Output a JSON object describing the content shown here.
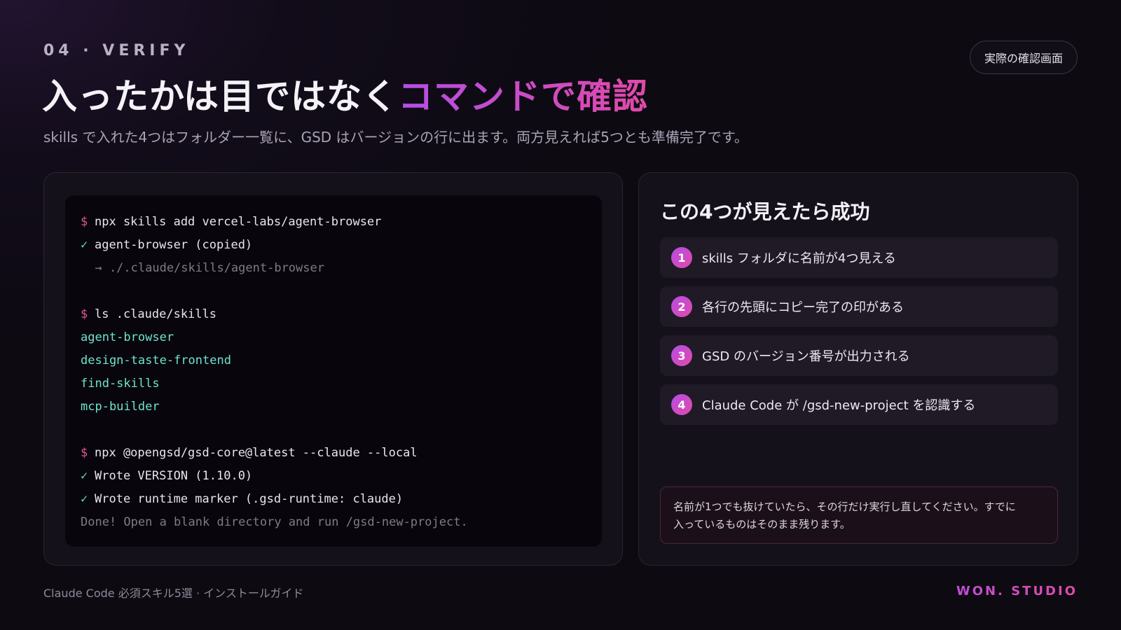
{
  "header": {
    "eyebrow": "04 · VERIFY",
    "title_plain": "入ったかは目ではなく",
    "title_accent": "コマンドで確認",
    "subtitle": "skills で入れた4つはフォルダー一覧に、GSD はバージョンの行に出ます。両方見えれば5つとも準備完了です。",
    "pill_label": "実際の確認画面"
  },
  "terminal": {
    "lines": [
      {
        "sym": "$",
        "sym_kind": "prompt",
        "text": "npx skills add vercel-labs/agent-browser",
        "style": "white"
      },
      {
        "sym": "✓",
        "sym_kind": "check",
        "text": "agent-browser (copied)",
        "style": "white"
      },
      {
        "sym": "",
        "sym_kind": "none",
        "text": "  → ./.claude/skills/agent-browser",
        "style": "dim"
      },
      {
        "sym": "",
        "sym_kind": "blank",
        "text": "",
        "style": "white"
      },
      {
        "sym": "$",
        "sym_kind": "prompt",
        "text": "ls .claude/skills",
        "style": "white"
      },
      {
        "sym": "",
        "sym_kind": "none",
        "text": "agent-browser",
        "style": "teal"
      },
      {
        "sym": "",
        "sym_kind": "none",
        "text": "design-taste-frontend",
        "style": "teal"
      },
      {
        "sym": "",
        "sym_kind": "none",
        "text": "find-skills",
        "style": "teal"
      },
      {
        "sym": "",
        "sym_kind": "none",
        "text": "mcp-builder",
        "style": "teal"
      },
      {
        "sym": "",
        "sym_kind": "blank",
        "text": "",
        "style": "white"
      },
      {
        "sym": "$",
        "sym_kind": "prompt",
        "text": "npx @opengsd/gsd-core@latest --claude --local",
        "style": "white"
      },
      {
        "sym": "✓",
        "sym_kind": "check",
        "text": "Wrote VERSION (1.10.0)",
        "style": "white"
      },
      {
        "sym": "✓",
        "sym_kind": "check",
        "text": "Wrote runtime marker (.gsd-runtime: claude)",
        "style": "white"
      },
      {
        "sym": "",
        "sym_kind": "none",
        "text": "Done! Open a blank directory and run /gsd-new-project.",
        "style": "dim"
      }
    ]
  },
  "checklist": {
    "title": "この4つが見えたら成功",
    "items": [
      {
        "num": "1",
        "text": "skills フォルダに名前が4つ見える"
      },
      {
        "num": "2",
        "text": "各行の先頭にコピー完了の印がある"
      },
      {
        "num": "3",
        "text": "GSD のバージョン番号が出力される"
      },
      {
        "num": "4",
        "text": "Claude Code が /gsd-new-project を認識する"
      }
    ],
    "note_line1": "名前が1つでも抜けていたら、その行だけ実行し直してください。すでに",
    "note_line2": "入っているものはそのまま残ります。"
  },
  "footer": {
    "left": "Claude Code 必須スキル5選 · インストールガイド",
    "right": "WON. STUDIO"
  },
  "colors": {
    "accent_purple": "#b44ee6",
    "accent_pink": "#e04aa8",
    "terminal_teal": "#6fe3cf",
    "prompt_pink": "#e0569a"
  }
}
